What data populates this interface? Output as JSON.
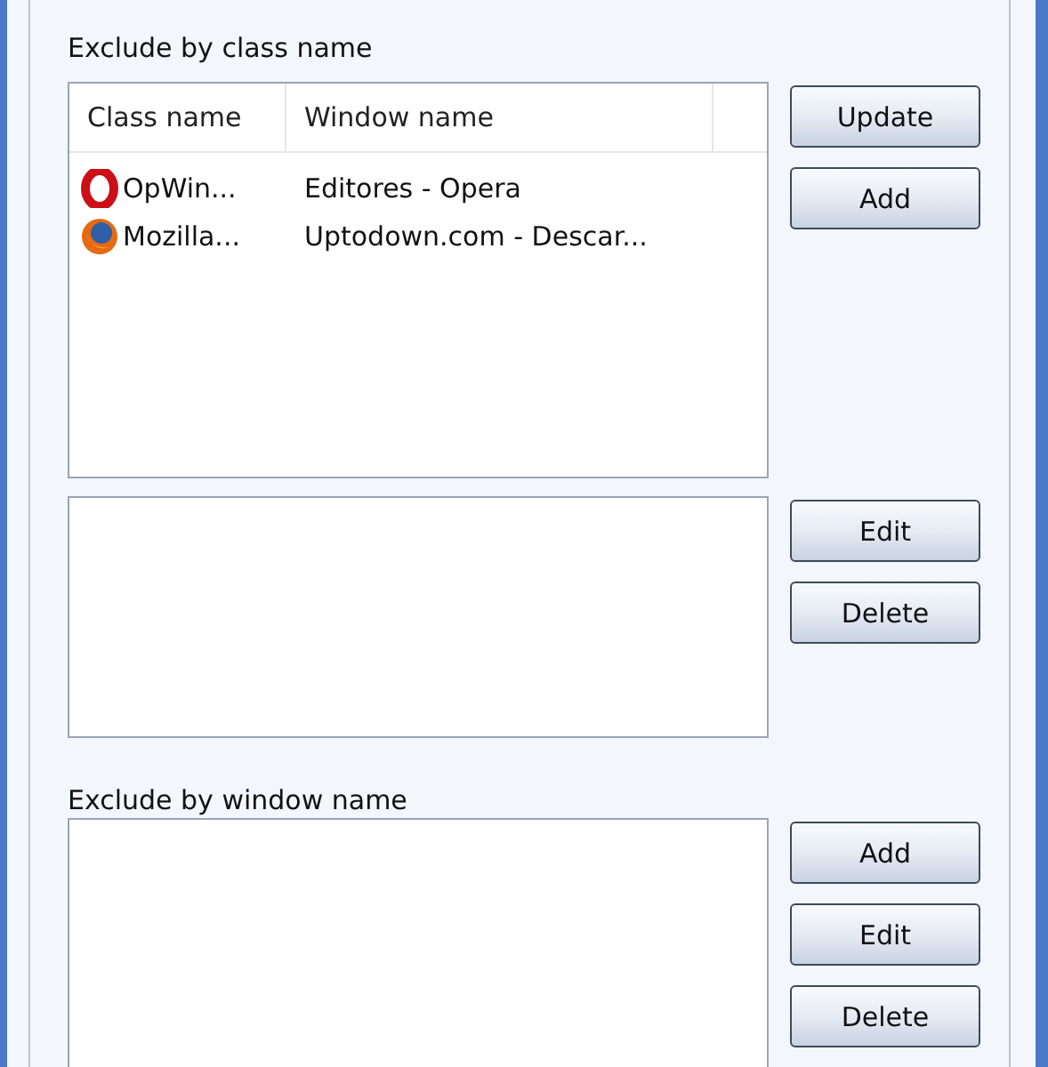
{
  "class_section": {
    "label": "Exclude by class name",
    "columns": [
      "Class name",
      "Window name"
    ],
    "rows": [
      {
        "kind": "opera",
        "class_name": "OpWin...",
        "window_name": "Editores - Opera"
      },
      {
        "kind": "firefox",
        "class_name": "Mozilla...",
        "window_name": "Uptodown.com - Descar..."
      }
    ],
    "list_buttons": [
      "Update",
      "Add"
    ],
    "detail_buttons": [
      "Edit",
      "Delete"
    ]
  },
  "window_section": {
    "label": "Exclude by window name",
    "buttons": [
      "Add",
      "Edit",
      "Delete"
    ]
  }
}
